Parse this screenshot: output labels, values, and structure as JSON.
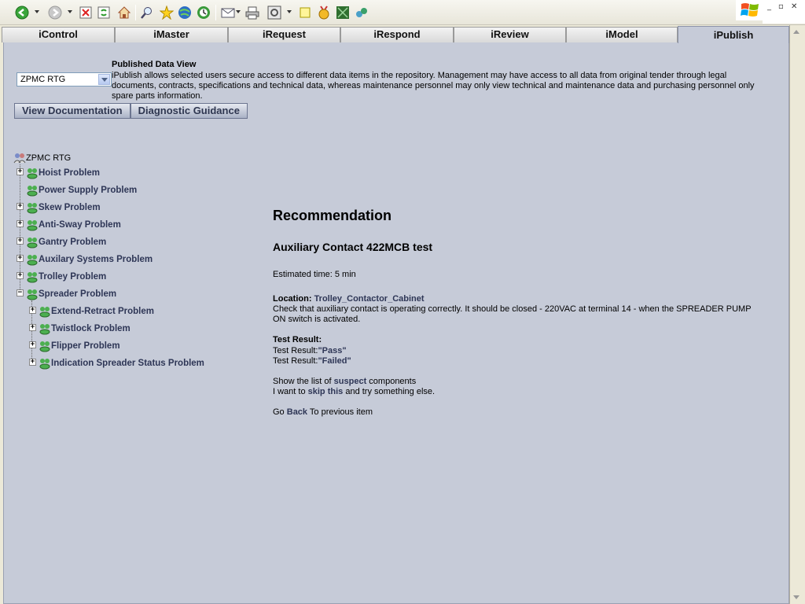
{
  "toolbar": {
    "icons": [
      "back-icon",
      "forward-icon",
      "stop-icon",
      "refresh-icon",
      "home-icon",
      "search-icon",
      "favorites-icon",
      "media-icon",
      "history-icon",
      "mail-icon",
      "print-icon",
      "edit-icon",
      "discuss-icon",
      "messenger-icon",
      "research-icon"
    ]
  },
  "tabs": [
    {
      "label": "iControl"
    },
    {
      "label": "iMaster"
    },
    {
      "label": "iRequest"
    },
    {
      "label": "iRespond"
    },
    {
      "label": "iReview"
    },
    {
      "label": "iModel"
    },
    {
      "label": "iPublish",
      "active": true
    }
  ],
  "data_view": {
    "title": "Published Data View",
    "description": "iPublish allows selected users secure access to different data items in the repository. Management may have access to all data from original tender through legal documents, contracts, specifications and technical data, whereas maintenance personnel may only view technical and maintenance data and purchasing personnel only spare parts information.",
    "selected_equipment": "ZPMC RTG",
    "buttons": {
      "view_documentation": "View Documentation",
      "diagnostic_guidance": "Diagnostic Guidance"
    }
  },
  "tree": {
    "root": "ZPMC RTG",
    "items": [
      {
        "label": "Hoist Problem",
        "expandable": true
      },
      {
        "label": "Power Supply Problem",
        "expandable": false
      },
      {
        "label": "Skew Problem",
        "expandable": true
      },
      {
        "label": "Anti-Sway Problem",
        "expandable": true
      },
      {
        "label": "Gantry Problem",
        "expandable": true
      },
      {
        "label": "Auxilary Systems Problem",
        "expandable": true
      },
      {
        "label": "Trolley Problem",
        "expandable": true
      },
      {
        "label": "Spreader Problem",
        "expandable": true,
        "expanded": true
      }
    ],
    "children": [
      {
        "label": "Extend-Retract Problem"
      },
      {
        "label": "Twistlock Problem"
      },
      {
        "label": "Flipper Problem"
      },
      {
        "label": "Indication Spreader Status Problem"
      }
    ]
  },
  "recommendation": {
    "heading": "Recommendation",
    "test_name": "Auxiliary Contact 422MCB test",
    "estimated_time": "Estimated time: 5 min",
    "location_label": "Location:",
    "location_value": "Trolley_Contactor_Cabinet",
    "instructions": "Check that auxiliary contact is operating correctly. It should be closed - 220VAC at terminal 14 - when the SPREADER PUMP ON switch is activated.",
    "test_result_heading": "Test Result:",
    "test_result_prefix": "Test Result:",
    "results": [
      "\"Pass\"",
      "\"Failed\""
    ],
    "show_list_prefix": "Show the list of",
    "show_list_link": "suspect",
    "show_list_suffix": "components",
    "skip_prefix": "I want to",
    "skip_link": "skip this",
    "skip_suffix": "and try something else.",
    "back_prefix": "Go",
    "back_link": "Back",
    "back_suffix": "To previous item"
  }
}
